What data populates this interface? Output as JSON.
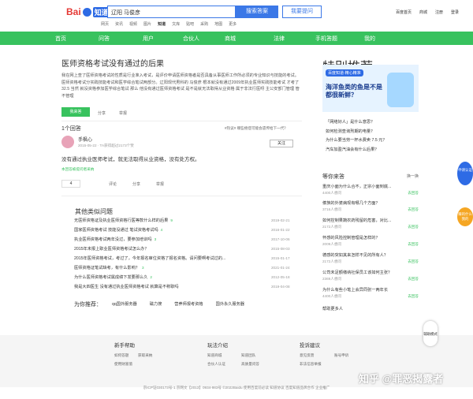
{
  "header": {
    "logo_text": "Bai",
    "logo_tag": "知道",
    "search_value": "辽阳 马俊彦",
    "search_button": "搜索答案",
    "ask_button": "我要提问",
    "top_links": [
      "百度首页",
      "商城",
      "注册",
      "登录"
    ],
    "subnav": [
      "网页",
      "资讯",
      "视频",
      "图片",
      "知道",
      "文库",
      "贴吧",
      "采购",
      "地图",
      "更多"
    ]
  },
  "nav": [
    "首页",
    "问答",
    "用户",
    "合伙人",
    "商城",
    "法律",
    "手机答题",
    "我的"
  ],
  "question": {
    "title": "医师资格考试没有通过的后果",
    "desc": "我在网上查了医师资格考试的性质是行业准入考试，是评价申请医师资格者是否具备从事医师工作所必须的专业知识与技能的考试。医师资格考试分实践技能考试和医学综合笔试两部分。辽阳现代男科的 马俊彦 根本就没有通过2009年执业医师实践技能考试 才考了32.5 当然 就没资格参加医学综合笔试 那么 他没有通过医师资格考试 是不是就无法取得从业资格 属于非法行医呀 主公安部门管理 管不管理",
    "follow_label": "我来答",
    "share_label": "分享",
    "report_label": "举报"
  },
  "answers": {
    "count_label": "1个回答",
    "sort_hint": "#热议# 哪些癌症可能会遗传给下一代？",
    "user": "手枫心",
    "meta": "2015-05-22 · TA获得超过2173个赞",
    "follow_btn": "关注",
    "content": "没有通过执业医师考试，就无法取得从业资格，没有处方权。",
    "helpful_note": "本回答被提问者采纳",
    "likes": "4",
    "actions": [
      "评论",
      "分享",
      "举报"
    ]
  },
  "related": {
    "title": "其他类似问题",
    "items": [
      {
        "q": "无医师资格证及执业医师资格行医等款什么样的后果",
        "c": "9",
        "d": "2019-02-21"
      },
      {
        "q": "国家医师资格考试 技能没通过 笔试资格考试吗",
        "c": "4",
        "d": "2016-01-22"
      },
      {
        "q": "执业医师资格考试两年没过，要参加培训吗",
        "c": "3",
        "d": "2017-10-06"
      },
      {
        "q": "2015年未报上职业医师资格考试怎么办？",
        "c": "",
        "d": "2015-08-03"
      },
      {
        "q": "2015年医师资格考试，考过了，今年报名审位资格了报名资格。请问要啊考试过的...",
        "c": "",
        "d": "2015-01-17"
      },
      {
        "q": "医师资格证笔试缺考，有什么影响？",
        "c": "3",
        "d": "2021-01-24"
      },
      {
        "q": "为什么医师资格考试属成绩下发要那么久",
        "c": "2",
        "d": "2012-05-18"
      },
      {
        "q": "我是大四医生 没有通过执业医师资格考试 就算是不称职吗",
        "c": "",
        "d": "2019-04-08"
      }
    ],
    "recommend_label": "为你推荐：",
    "recommend_tags": [
      "qq国外服务器",
      "磁力搜",
      "营养师报考资格",
      "国外永久服务器"
    ]
  },
  "sidebar": {
    "special_title": "特别推荐",
    "ad_tag": "百度知道·精心精准",
    "ad_text": "海洋鱼类的鱼是不是都很新鲜？",
    "hot": [
      "「网络好人」是什么意思？",
      "如何检测查询刑期的电量？",
      "为什么要当劳一杯水费卖 7.5 元？",
      "汽车加盈汽油会有什么后果？"
    ],
    "rank_title": "等你来答",
    "rank_more": "换一换",
    "rank_items": [
      {
        "q": "重庆小面为什么合不，正宗小面到底...",
        "m": "4400人想问"
      },
      {
        "q": "傣族的外婆病现有哪几个方面？",
        "m": "3716人想问"
      },
      {
        "q": "如何控制果蔬农药残留的危害，对比...",
        "m": "2172人想问"
      },
      {
        "q": "怀感的风险控制管理是怎样的？",
        "m": "2009人想问"
      },
      {
        "q": "德感的突如其来怎样不见的所有人？",
        "m": "2172人想问"
      },
      {
        "q": "公司未足额缴纳社保员工该如何主张？",
        "m": "2369人想问"
      },
      {
        "q": "为什么有些小笔上会异同张一两年长",
        "m": "4400人想问"
      }
    ],
    "more_label": "帮助更多人",
    "answer_label": "去回答"
  },
  "footer": {
    "sections": [
      {
        "title": "新手帮助",
        "links": [
          "如何答题",
          "获取采纳",
          "使用财富值"
        ]
      },
      {
        "title": "玩法介绍",
        "links": [
          "知道商城",
          "合伙人认证",
          "知道团队",
          "高质量问答"
        ]
      },
      {
        "title": "投诉建议",
        "links": [
          "意见反馈",
          "账号申诉",
          "非法信息举报"
        ]
      }
    ],
    "copyright": "京ICP证030173号-1  京网文【2013】0934-983号  ©2022Baidu  使用百度前必读  知道协议  百度知道品牌合作  企业推广",
    "watermark": "知乎 @罪恶揭露者"
  },
  "floats": [
    "申请认证",
    "赚的什么我的",
    "辅助模式"
  ]
}
